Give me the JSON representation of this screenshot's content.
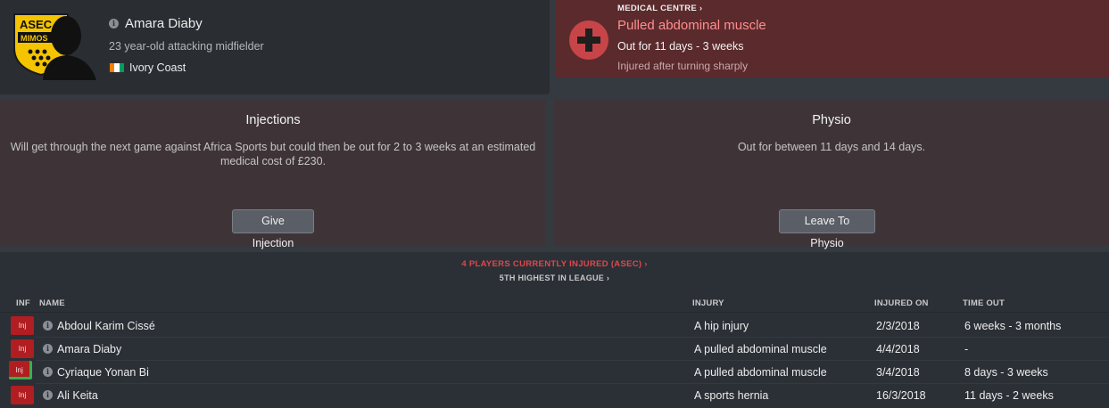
{
  "player": {
    "name": "Amara Diaby",
    "description": "23 year-old attacking midfielder",
    "nationality": "Ivory Coast",
    "club_badge_text": "ASEC MIMOS",
    "flag_colors": [
      "#f77f00",
      "#ffffff",
      "#009e60"
    ]
  },
  "medical": {
    "label": "MEDICAL CENTRE",
    "injury": "Pulled abdominal muscle",
    "out_for": "Out for 11 days - 3 weeks",
    "note": "Injured after turning sharply"
  },
  "injections": {
    "title": "Injections",
    "text": "Will get through the next game against Africa Sports but could then be out for 2 to 3 weeks at an estimated medical cost of £230.",
    "button": "Give Injection"
  },
  "physio": {
    "title": "Physio",
    "text": "Out for between 11 days and 14 days.",
    "button": "Leave To Physio"
  },
  "summary": {
    "injured_count": "4 PLAYERS CURRENTLY INJURED (ASEC)",
    "league_rank": "5TH HIGHEST IN LEAGUE"
  },
  "table": {
    "headers": {
      "inf": "INF",
      "name": "NAME",
      "injury": "INJURY",
      "injured_on": "INJURED ON",
      "time_out": "TIME OUT"
    },
    "rows": [
      {
        "badge": "Inj",
        "name": "Abdoul Karim Cissé",
        "injury": "A hip injury",
        "injured_on": "2/3/2018",
        "time_out": "6 weeks - 3 months"
      },
      {
        "badge": "Inj",
        "name": "Amara Diaby",
        "injury": "A pulled abdominal muscle",
        "injured_on": "4/4/2018",
        "time_out": "-"
      },
      {
        "badge": "Inj",
        "name": "Cyriaque Yonan Bi",
        "injury": "A pulled abdominal muscle",
        "injured_on": "3/4/2018",
        "time_out": "8 days - 3 weeks"
      },
      {
        "badge": "Inj",
        "name": "Ali Keita",
        "injury": "A sports hernia",
        "injured_on": "16/3/2018",
        "time_out": "11 days - 2 weeks"
      }
    ]
  }
}
